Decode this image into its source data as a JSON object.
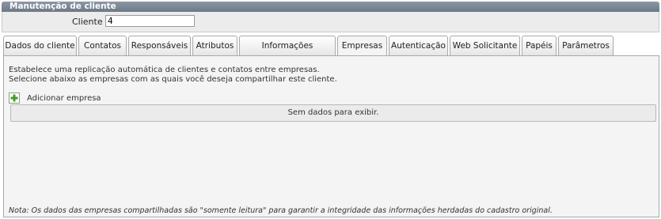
{
  "window": {
    "title": "Manutenção de cliente"
  },
  "cliente": {
    "label": "Cliente :",
    "value": "4"
  },
  "tabs": [
    {
      "label": "Dados do cliente"
    },
    {
      "label": "Contatos"
    },
    {
      "label": "Responsáveis"
    },
    {
      "label": "Atributos"
    },
    {
      "label": "Informações adicionais"
    },
    {
      "label": "Empresas",
      "active": true
    },
    {
      "label": "Autenticação"
    },
    {
      "label": "Web Solicitante"
    },
    {
      "label": "Papéis"
    },
    {
      "label": "Parâmetros"
    }
  ],
  "panel": {
    "description_line1": "Estabelece uma replicação automática de clientes e contatos entre empresas.",
    "description_line2": "Selecione abaixo as empresas com as quais você deseja compartilhar este cliente.",
    "add_label": "Adicionar empresa",
    "add_icon": "plus-icon",
    "empty_text": "Sem dados para exibir.",
    "note": "Nota: Os dados das empresas compartilhadas são \"somente leitura\" para garantir a integridade das informações herdadas do cadastro original."
  },
  "colors": {
    "title_bar": "#7b8794",
    "add_icon": "#4a9a2a",
    "panel_bg": "#f4f4f4"
  }
}
